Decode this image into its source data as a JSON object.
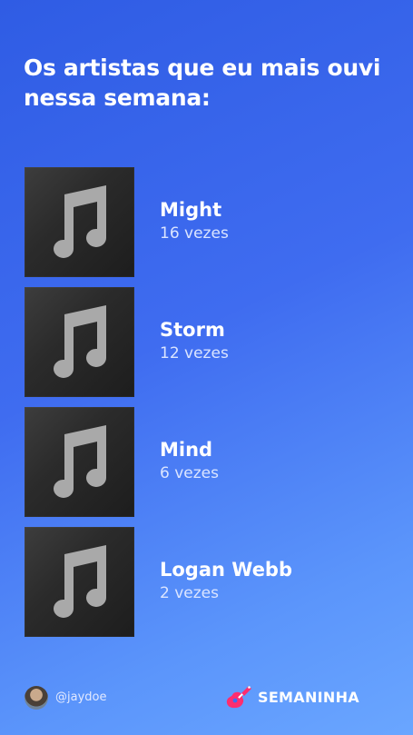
{
  "header": {
    "title": "Os artistas que eu mais ouvi nessa semana:"
  },
  "artists": [
    {
      "name": "Might",
      "plays": "16 vezes"
    },
    {
      "name": "Storm",
      "plays": "12 vezes"
    },
    {
      "name": "Mind",
      "plays": "6 vezes"
    },
    {
      "name": "Logan Webb",
      "plays": "2 vezes"
    }
  ],
  "footer": {
    "username": "@jaydoe",
    "avatar_icon": "user-avatar",
    "brand_icon": "guitar-icon",
    "brand_name": "SEMANINHA"
  },
  "colors": {
    "gradient_start": "#2f5ce4",
    "gradient_end": "#6aa6ff",
    "brand_accent": "#ff2d6f",
    "art_background": "#2b2b2b",
    "note_icon": "#a9a9a9"
  }
}
